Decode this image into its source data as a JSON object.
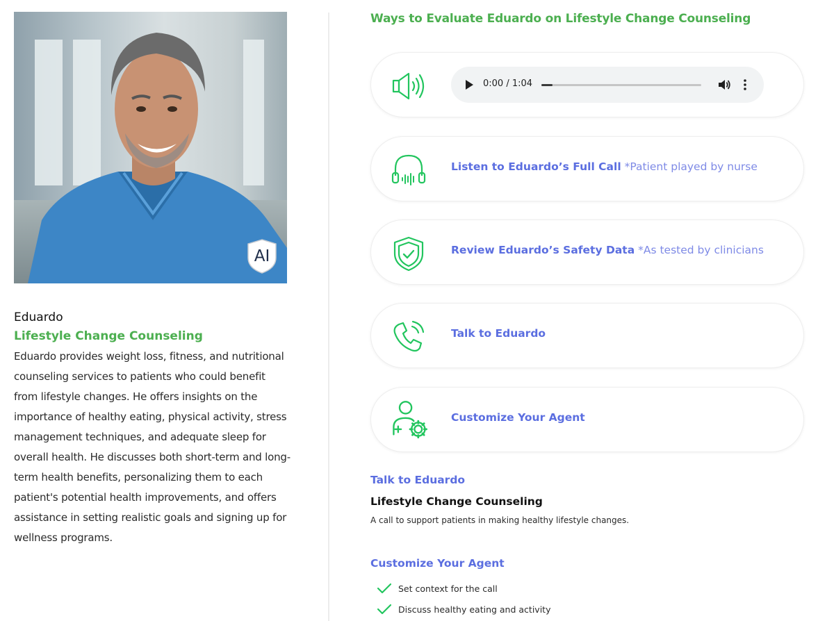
{
  "agent": {
    "name": "Eduardo",
    "role": "Lifestyle Change Counseling",
    "description": "Eduardo provides weight loss, fitness, and nutritional counseling services to patients who could benefit from lifestyle changes. He offers insights on the importance of healthy eating, physical activity, stress management techniques, and adequate sleep for overall health. He discusses both short-term and long-term health benefits, personalizing them to each patient's potential health improvements, and offers assistance in setting realistic goals and signing up for wellness programs.",
    "badge": "AI"
  },
  "evaluate": {
    "heading": "Ways to Evaluate Eduardo on Lifestyle Change Counseling",
    "audio": {
      "icon": "speaker-icon",
      "time": "0:00 / 1:04",
      "progress": 0.07
    },
    "cards": [
      {
        "icon": "headphones-icon",
        "title": "Listen to Eduardo’s Full Call",
        "note": "*Patient played by nurse"
      },
      {
        "icon": "shield-check-icon",
        "title": "Review Eduardo’s Safety Data",
        "note": "*As tested by clinicians"
      },
      {
        "icon": "phone-icon",
        "title": "Talk to Eduardo",
        "note": ""
      },
      {
        "icon": "user-gear-icon",
        "title": "Customize Your Agent",
        "note": ""
      }
    ]
  },
  "talk": {
    "heading": "Talk to Eduardo",
    "title": "Lifestyle Change Counseling",
    "description": "A call to support patients in making healthy lifestyle changes."
  },
  "customize": {
    "heading": "Customize Your Agent",
    "items": [
      "Set context for the call",
      "Discuss healthy eating and activity"
    ]
  },
  "colors": {
    "green": "#4caf50",
    "icon_green": "#22c55e",
    "blue": "#5b6ee0"
  }
}
